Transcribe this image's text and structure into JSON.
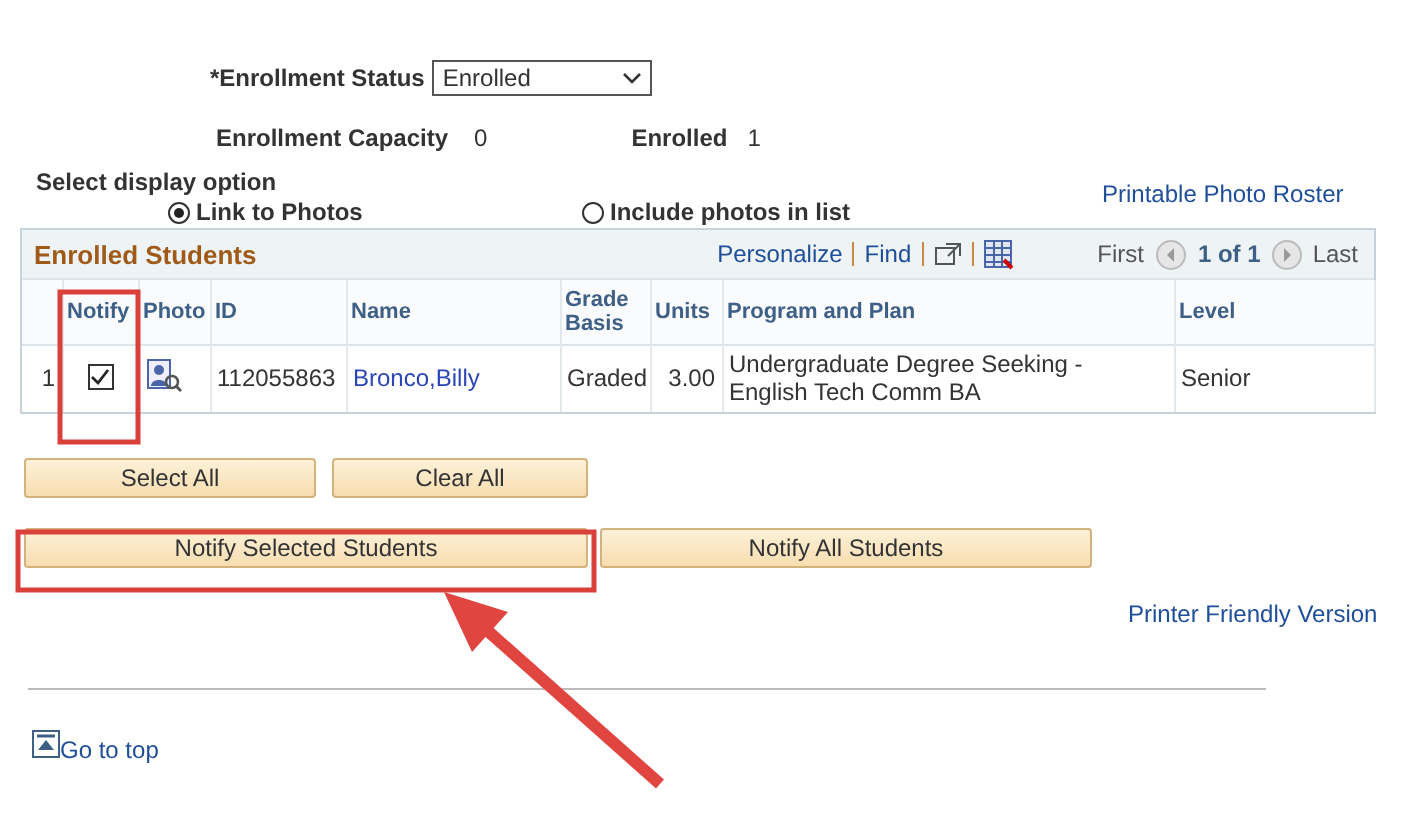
{
  "enrollment_status": {
    "label": "*Enrollment Status",
    "value": "Enrolled"
  },
  "capacity": {
    "label": "Enrollment Capacity",
    "value": "0"
  },
  "enrolled": {
    "label": "Enrolled",
    "value": "1"
  },
  "display_option": {
    "label": "Select display option",
    "options": [
      {
        "label": "Link to Photos",
        "selected": true
      },
      {
        "label": "Include photos in list",
        "selected": false
      }
    ]
  },
  "photo_roster_link": "Printable Photo Roster",
  "grid": {
    "title": "Enrolled Students",
    "tools": [
      "Personalize",
      "Find"
    ],
    "nav": {
      "first": "First",
      "range": "1 of 1",
      "last": "Last"
    },
    "columns": [
      "",
      "Notify",
      "Photo",
      "ID",
      "Name",
      "Grade Basis",
      "Units",
      "Program and Plan",
      "Level"
    ],
    "rows": [
      {
        "number": "1",
        "notify": true,
        "id": "112055863",
        "name": "Bronco,Billy",
        "grade_basis": "Graded",
        "units": "3.00",
        "program": "Undergraduate Degree Seeking - English Tech Comm BA",
        "level": "Senior"
      }
    ]
  },
  "select_buttons": [
    "Select All",
    "Clear All"
  ],
  "notify_buttons": [
    "Notify Selected Students",
    "Notify All Students"
  ],
  "printer_link": "Printer Friendly Version",
  "top_link": "Go to top"
}
